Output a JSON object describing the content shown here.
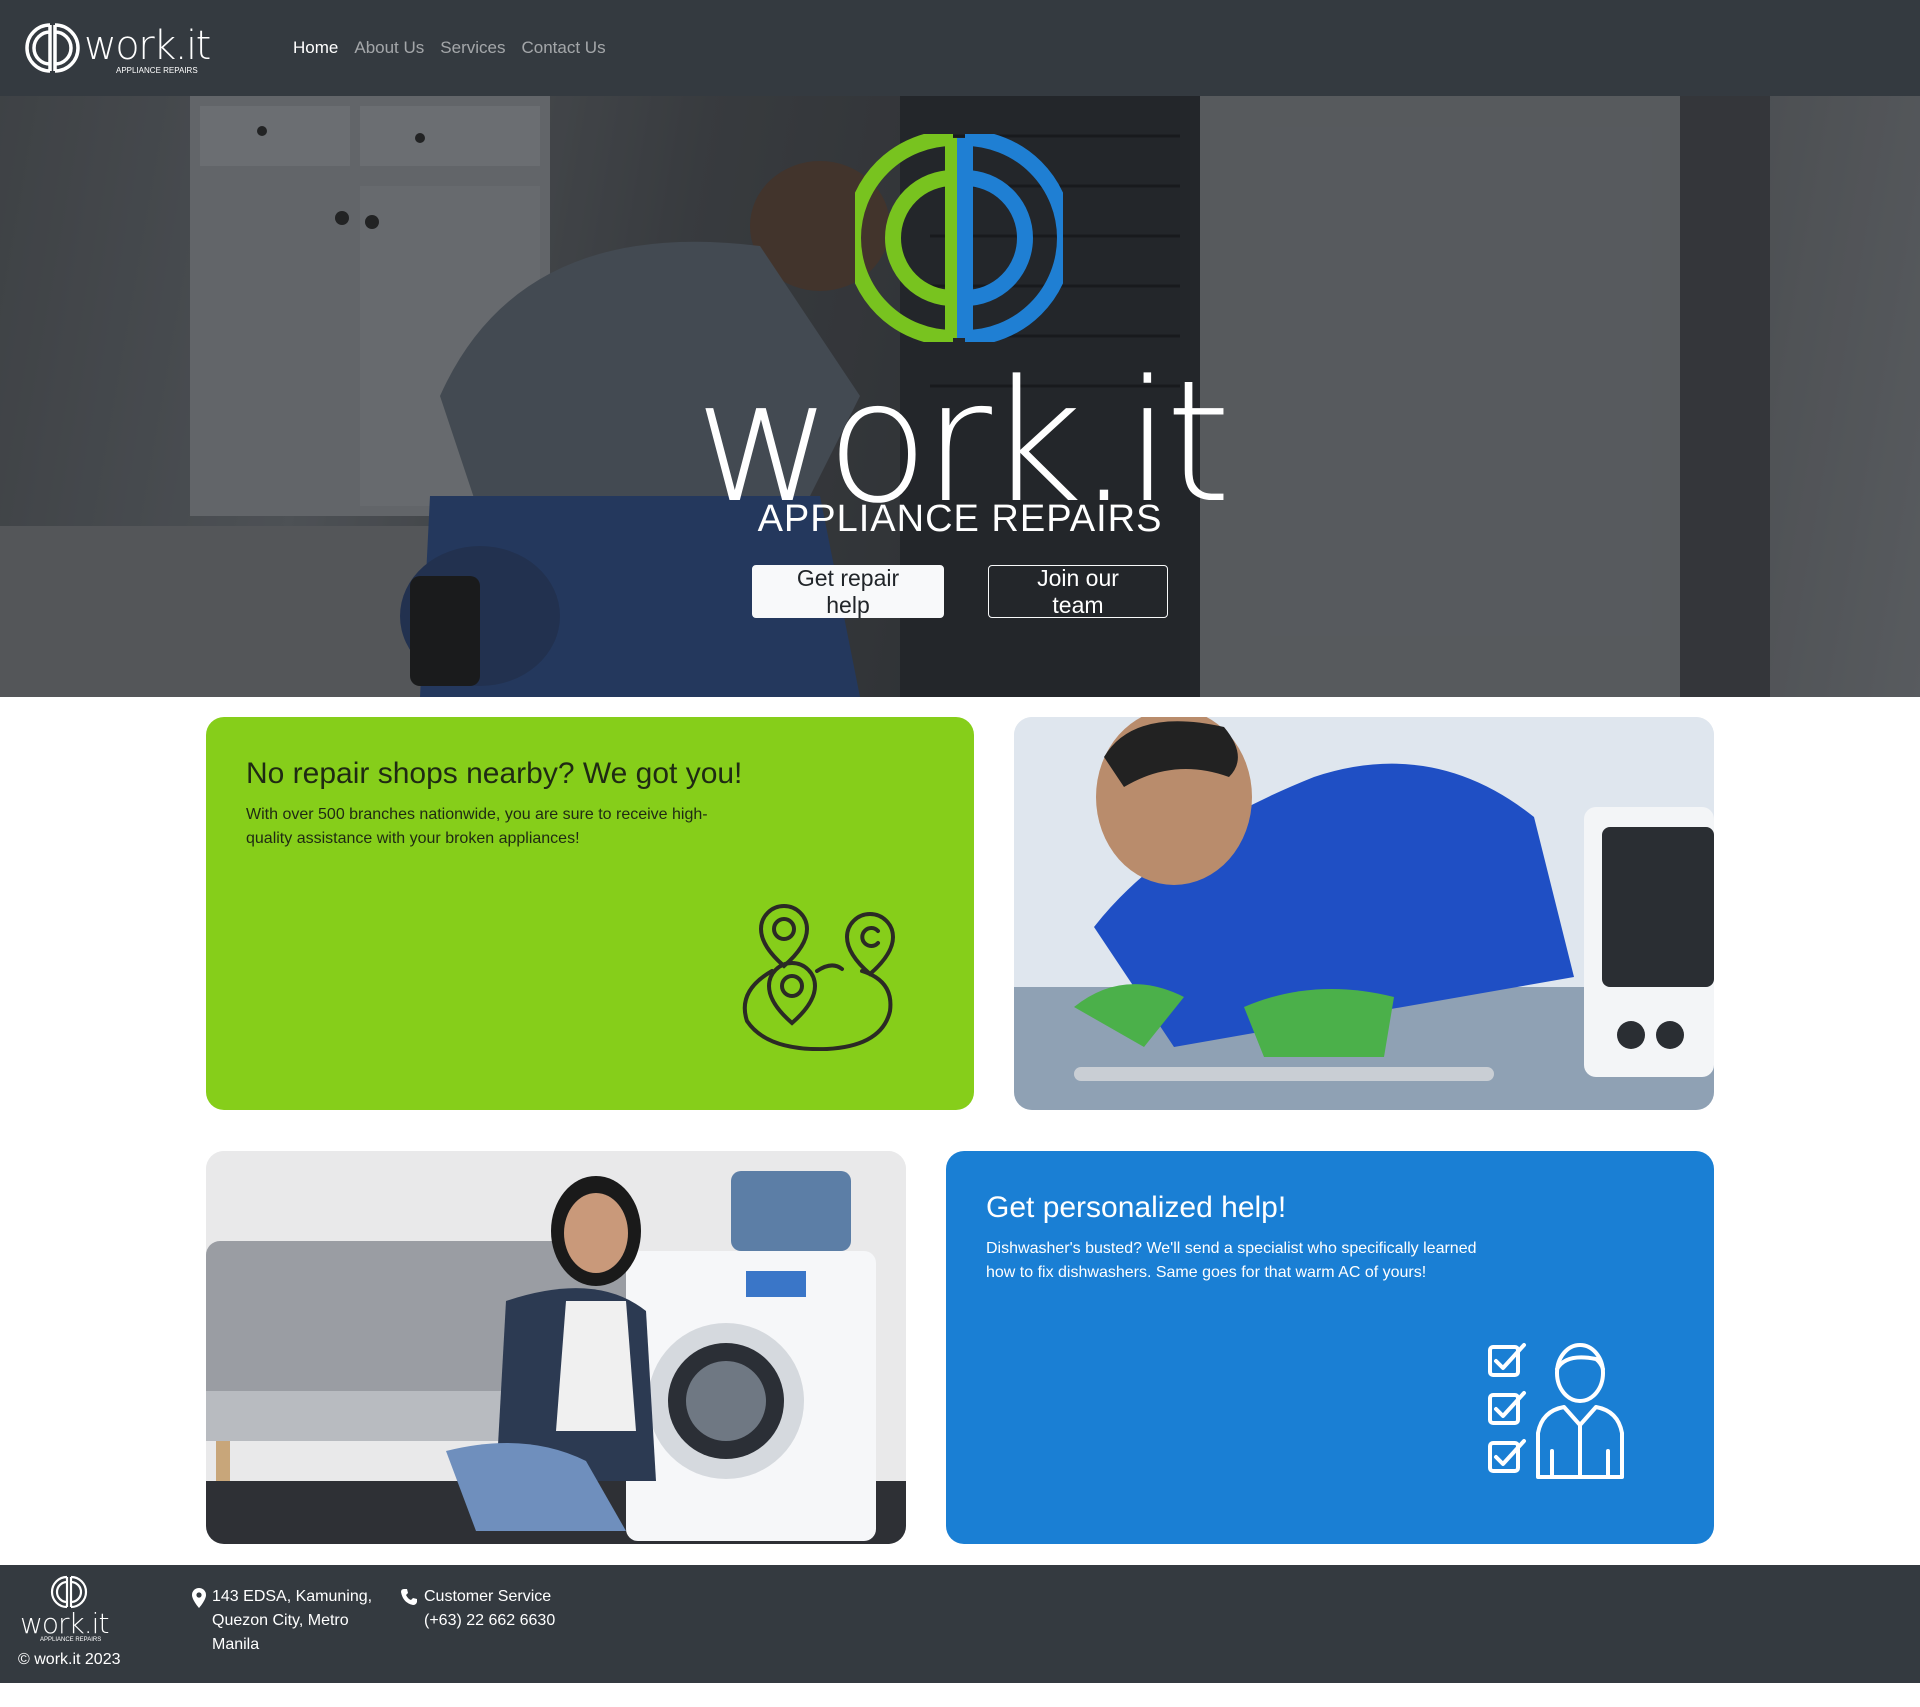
{
  "brand": {
    "name": "work.it",
    "tagline": "APPLIANCE REPAIRS",
    "colors": {
      "green": "#86ce1a",
      "blue": "#1a7fd4",
      "dark": "#343a40"
    }
  },
  "nav": {
    "items": [
      {
        "label": "Home",
        "active": true
      },
      {
        "label": "About Us",
        "active": false
      },
      {
        "label": "Services",
        "active": false
      },
      {
        "label": "Contact Us",
        "active": false
      }
    ]
  },
  "hero": {
    "title": "work.it",
    "subtitle": "APPLIANCE REPAIRS",
    "primary_button": "Get repair help",
    "secondary_button": "Join our team"
  },
  "features": {
    "nearby": {
      "title": "No repair shops nearby? We got you!",
      "text": "With over 500 branches nationwide, you are sure to receive high-quality assistance with your broken appliances!",
      "icon": "map-pins-icon"
    },
    "personalized": {
      "title": "Get personalized help!",
      "text": "Dishwasher's busted? We'll send a specialist who specifically learned how to fix dishwashers. Same goes for that warm AC of yours!",
      "icon": "checklist-specialist-icon"
    }
  },
  "footer": {
    "address": [
      "143 EDSA, Kamuning,",
      "Quezon City, Metro",
      "Manila"
    ],
    "phone_label": "Customer Service",
    "phone_number": "(+63) 22 662 6630",
    "copyright": "© work.it 2023"
  }
}
